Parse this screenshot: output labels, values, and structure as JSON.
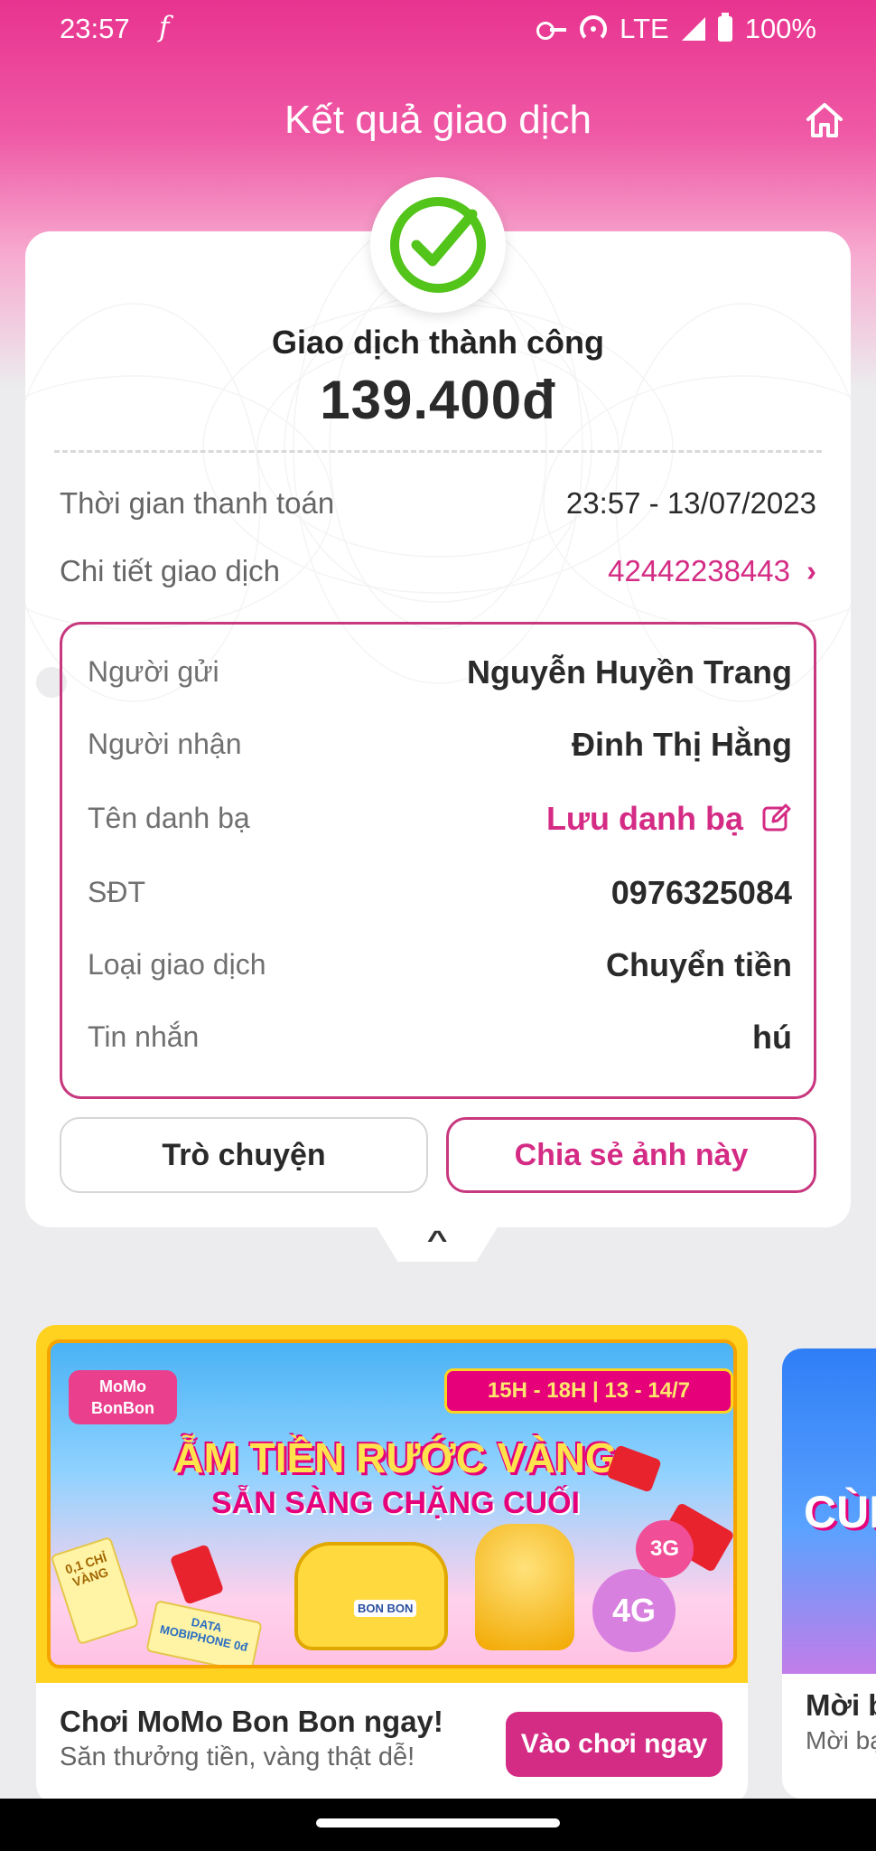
{
  "status_bar": {
    "time": "23:57",
    "app_glyph": "f",
    "network": "LTE",
    "battery": "100%"
  },
  "header": {
    "title": "Kết quả giao dịch",
    "home_icon": "home-icon"
  },
  "result": {
    "status": "Giao dịch thành công",
    "amount": "139.400đ",
    "icon": "check-circle-icon",
    "success_color": "#52c41a"
  },
  "info": {
    "payment_time_label": "Thời gian thanh toán",
    "payment_time_value": "23:57 - 13/07/2023",
    "detail_label": "Chi tiết giao dịch",
    "detail_value": "42442238443"
  },
  "details": [
    {
      "label": "Người gửi",
      "value": "Nguyễn Huyền Trang"
    },
    {
      "label": "Người nhận",
      "value": "Đinh Thị Hằng"
    },
    {
      "label": "Tên danh bạ",
      "value": "Lưu danh bạ"
    },
    {
      "label": "SĐT",
      "value": "0976325084"
    },
    {
      "label": "Loại giao dịch",
      "value": "Chuyển tiền"
    },
    {
      "label": "Tin nhắn",
      "value": "hú"
    }
  ],
  "actions": {
    "chat": "Trò chuyện",
    "share": "Chia sẻ ảnh này"
  },
  "promo": {
    "logo": "MoMo BonBon",
    "date_badge": "15H - 18H | 13 - 14/7",
    "headline": "ẴM TIỀN RƯỚC VÀNG",
    "subheadline": "SẴN SÀNG CHẶNG CUỐI",
    "ticket_text": "0,1 CHỈ VÀNG",
    "data_text": "DATA MOBIPHONE 0đ",
    "car_text": "BON BON",
    "bubble_4g": "4G",
    "bubble_3g": "3G",
    "title": "Chơi MoMo Bon Bon ngay!",
    "description": "Săn thưởng tiền, vàng thật dễ!",
    "button": "Vào chơi ngay"
  },
  "promo2": {
    "banner_text": "CÙN",
    "title": "Mời b",
    "description": "Mời bạ"
  },
  "colors": {
    "brand": "#d42c85",
    "border": "#c8387f",
    "header_gradient_top": "#e8338f"
  }
}
